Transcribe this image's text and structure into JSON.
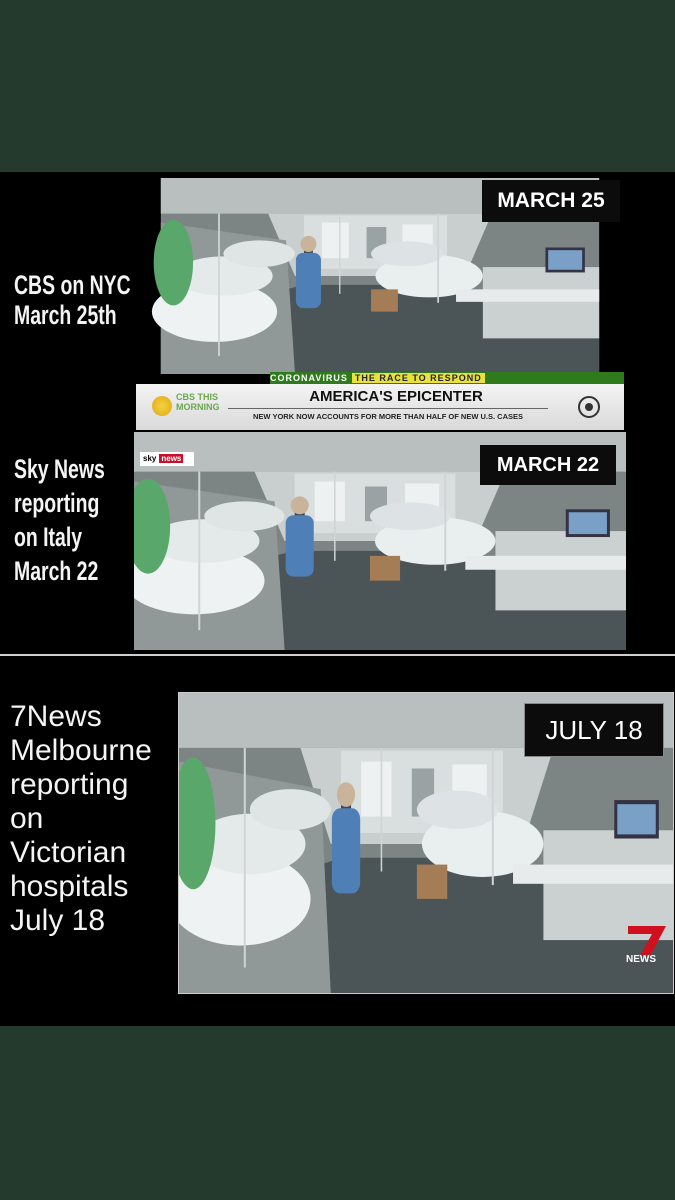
{
  "captions": {
    "cbs": [
      "CBS on NYC",
      "March 25th"
    ],
    "sky": [
      "Sky News",
      "reporting",
      "on Italy",
      "March 22"
    ],
    "seven": [
      "7News",
      "Melbourne",
      "reporting",
      "on",
      "Victorian",
      "hospitals",
      "July 18"
    ]
  },
  "badges": {
    "cbs": "MARCH 25",
    "sky": "MARCH 22",
    "seven": "JULY 18"
  },
  "cbs_chyron": {
    "top_label": "CORONAVIRUS",
    "top_highlight": "THE RACE TO RESPOND",
    "logo_text": [
      "CBS THIS",
      "MORNING"
    ],
    "headline": "AMERICA'S EPICENTER",
    "subline": "NEW YORK NOW ACCOUNTS FOR MORE THAN HALF OF NEW U.S. CASES"
  },
  "sky_logo": {
    "sky": "sky",
    "news": "news"
  },
  "seven_logo": {
    "text": "NEWS"
  }
}
